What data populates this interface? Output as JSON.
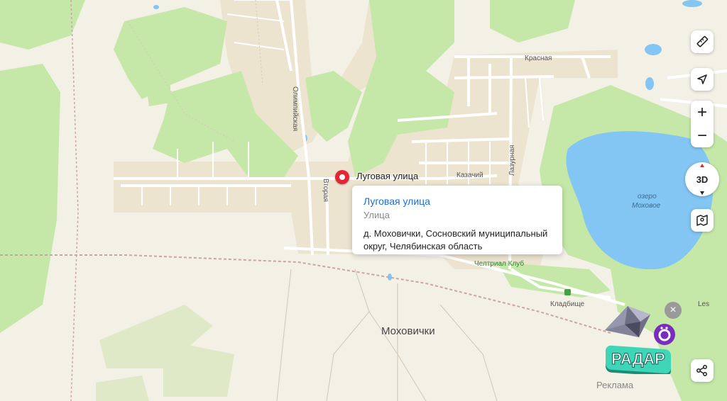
{
  "map": {
    "street_labels": {
      "krasnaya": "Красная",
      "olimpiyskaya": "Олимпийская",
      "vtoraya": "Вторая",
      "lazurnaya": "Лазурная",
      "kazachiy": "Казачий",
      "cheltrial": "Челтриал Клуб",
      "kladbishche": "Кладбище",
      "les": "Les",
      "lake_line1": "озеро",
      "lake_line2": "Моховое",
      "settlement": "Моховички"
    },
    "selected_marker": {
      "label": "Луговая улица",
      "color": "#e32636"
    },
    "colors": {
      "land": "#f3f0e6",
      "forest": "#c5e8a9",
      "residential": "#ece4cf",
      "water": "#83c5f3",
      "link": "#1a6fd4"
    }
  },
  "popup": {
    "title": "Луговая улица",
    "type": "Улица",
    "address": "д. Моховички, Сосновский муниципальный округ, Челябинская область"
  },
  "controls": {
    "three_d_label": "3D",
    "zoom_in": "+",
    "zoom_out": "−",
    "icons": [
      "ruler-icon",
      "navigation-arrow-icon",
      "compass-3d-icon",
      "map-layers-icon",
      "share-icon"
    ]
  },
  "ad": {
    "brand_text": "РАДАР",
    "label": "Реклама",
    "close": "×"
  }
}
